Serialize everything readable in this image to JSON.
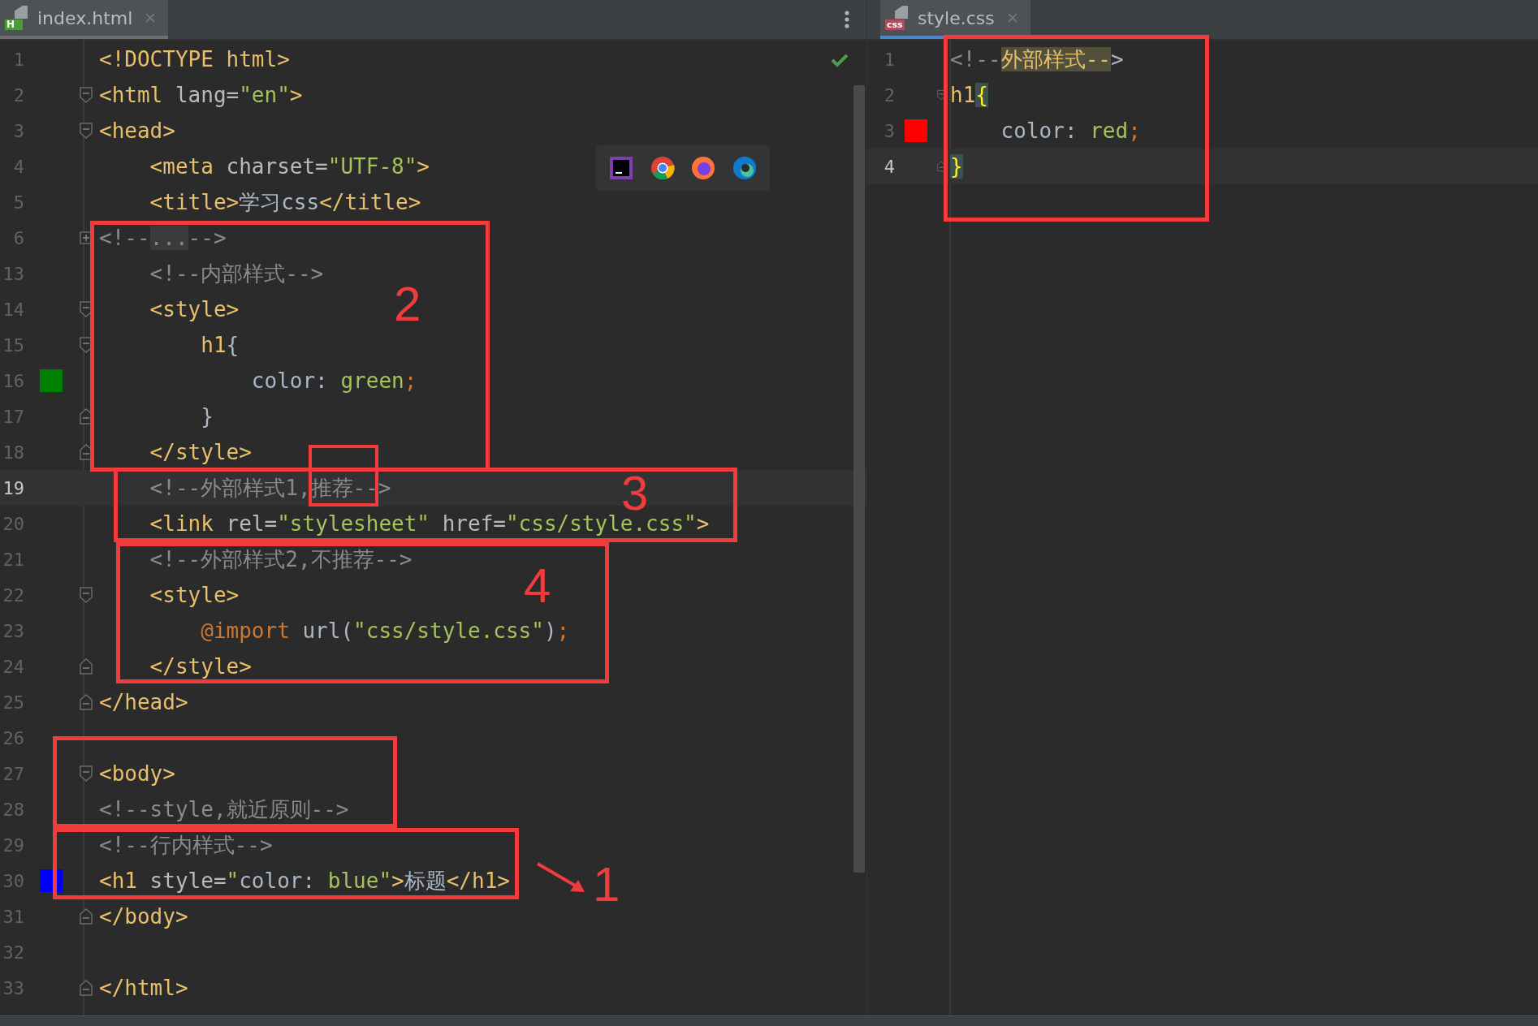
{
  "panels": [
    {
      "kind": "html",
      "tab": {
        "label": "index.html",
        "badge": "H",
        "focused": false
      },
      "lines": [
        {
          "number": "1",
          "kind": "plain",
          "current": false,
          "tokens": [
            {
              "text": "<!DOCTYPE html>",
              "kind": "tag"
            }
          ]
        },
        {
          "number": "2",
          "kind": "open",
          "current": false,
          "tokens": [
            {
              "text": "<html",
              "kind": "tag"
            },
            {
              "text": " lang=",
              "kind": "attr"
            },
            {
              "text": "\"en\"",
              "kind": "string"
            },
            {
              "text": ">",
              "kind": "tag"
            }
          ]
        },
        {
          "number": "3",
          "kind": "open",
          "current": false,
          "tokens": [
            {
              "text": "<head>",
              "kind": "tag"
            }
          ]
        },
        {
          "number": "4",
          "kind": "plain",
          "current": false,
          "tokens": [
            {
              "text": "    <meta",
              "kind": "tag"
            },
            {
              "text": " charset=",
              "kind": "attr"
            },
            {
              "text": "\"UTF-8\"",
              "kind": "string"
            },
            {
              "text": ">",
              "kind": "tag"
            }
          ]
        },
        {
          "number": "5",
          "kind": "plain",
          "current": false,
          "tokens": [
            {
              "text": "    <title>",
              "kind": "tag"
            },
            {
              "text": "学习css",
              "kind": "text"
            },
            {
              "text": "</title>",
              "kind": "tag"
            }
          ]
        },
        {
          "number": "6",
          "kind": "collapsed",
          "current": false,
          "tokens": [
            {
              "text": "<!--",
              "kind": "comment"
            },
            {
              "text": "...",
              "kind": "folded"
            },
            {
              "text": "-->",
              "kind": "comment"
            }
          ]
        },
        {
          "number": "13",
          "kind": "plain",
          "current": false,
          "tokens": [
            {
              "text": "    <!--内部样式-->",
              "kind": "comment"
            }
          ]
        },
        {
          "number": "14",
          "kind": "open",
          "current": false,
          "tokens": [
            {
              "text": "    <style>",
              "kind": "tag"
            }
          ]
        },
        {
          "number": "15",
          "kind": "open",
          "current": false,
          "tokens": [
            {
              "text": "        h1",
              "kind": "selector"
            },
            {
              "text": "{",
              "kind": "plain"
            }
          ]
        },
        {
          "number": "16",
          "kind": "plain",
          "current": false,
          "color": "#008000",
          "tokens": [
            {
              "text": "            color: ",
              "kind": "plain"
            },
            {
              "text": "green",
              "kind": "value"
            },
            {
              "text": ";",
              "kind": "punct"
            }
          ]
        },
        {
          "number": "17",
          "kind": "close",
          "current": false,
          "tokens": [
            {
              "text": "        }",
              "kind": "plain"
            }
          ]
        },
        {
          "number": "18",
          "kind": "close",
          "current": false,
          "tokens": [
            {
              "text": "    </style>",
              "kind": "tag"
            }
          ]
        },
        {
          "number": "19",
          "kind": "plain",
          "current": true,
          "tokens": [
            {
              "text": "    <!--外部样式1,推荐-->",
              "kind": "comment"
            }
          ]
        },
        {
          "number": "20",
          "kind": "plain",
          "current": false,
          "tokens": [
            {
              "text": "    <link",
              "kind": "tag"
            },
            {
              "text": " rel=",
              "kind": "attr"
            },
            {
              "text": "\"stylesheet\"",
              "kind": "string"
            },
            {
              "text": " href=",
              "kind": "attr"
            },
            {
              "text": "\"css/style.css\"",
              "kind": "string"
            },
            {
              "text": ">",
              "kind": "tag"
            }
          ]
        },
        {
          "number": "21",
          "kind": "plain",
          "current": false,
          "tokens": [
            {
              "text": "    <!--外部样式2,不推荐-->",
              "kind": "comment"
            }
          ]
        },
        {
          "number": "22",
          "kind": "open",
          "current": false,
          "tokens": [
            {
              "text": "    <style>",
              "kind": "tag"
            }
          ]
        },
        {
          "number": "23",
          "kind": "plain",
          "current": false,
          "tokens": [
            {
              "text": "        @import",
              "kind": "keyword"
            },
            {
              "text": " url(",
              "kind": "plain"
            },
            {
              "text": "\"css/style.css\"",
              "kind": "value"
            },
            {
              "text": ")",
              "kind": "plain"
            },
            {
              "text": ";",
              "kind": "punct"
            }
          ]
        },
        {
          "number": "24",
          "kind": "close",
          "current": false,
          "tokens": [
            {
              "text": "    </style>",
              "kind": "tag"
            }
          ]
        },
        {
          "number": "25",
          "kind": "close",
          "current": false,
          "tokens": [
            {
              "text": "</head>",
              "kind": "tag"
            }
          ]
        },
        {
          "number": "26",
          "kind": "plain",
          "current": false
        },
        {
          "number": "27",
          "kind": "open",
          "current": false,
          "tokens": [
            {
              "text": "<body>",
              "kind": "tag"
            }
          ]
        },
        {
          "number": "28",
          "kind": "plain",
          "current": false,
          "tokens": [
            {
              "text": "<!--style,就近原则-->",
              "kind": "comment"
            }
          ]
        },
        {
          "number": "29",
          "kind": "plain",
          "current": false,
          "tokens": [
            {
              "text": "<!--行内样式-->",
              "kind": "comment"
            }
          ]
        },
        {
          "number": "30",
          "kind": "plain",
          "current": false,
          "color": "#0000ff",
          "tokens": [
            {
              "text": "<h1",
              "kind": "tag"
            },
            {
              "text": " style=",
              "kind": "attr"
            },
            {
              "text": "\"",
              "kind": "string"
            },
            {
              "text": "color: ",
              "kind": "plain"
            },
            {
              "text": "blue",
              "kind": "value"
            },
            {
              "text": "\"",
              "kind": "string"
            },
            {
              "text": ">",
              "kind": "tag"
            },
            {
              "text": "标题",
              "kind": "text"
            },
            {
              "text": "</h1>",
              "kind": "tag"
            }
          ]
        },
        {
          "number": "31",
          "kind": "close",
          "current": false,
          "tokens": [
            {
              "text": "</body>",
              "kind": "tag"
            }
          ]
        },
        {
          "number": "32",
          "kind": "plain",
          "current": false
        },
        {
          "number": "33",
          "kind": "close",
          "current": false,
          "tokens": [
            {
              "text": "</html>",
              "kind": "tag"
            }
          ]
        }
      ]
    },
    {
      "kind": "css",
      "tab": {
        "label": "style.css",
        "badge": "css",
        "focused": true
      },
      "lines": [
        {
          "number": "1",
          "kind": "plain",
          "current": false,
          "tokens": [
            {
              "text": "<!--",
              "kind": "comment"
            },
            {
              "text": "外部样式--",
              "kind": "highlight"
            },
            {
              "text": ">",
              "kind": "plain"
            }
          ]
        },
        {
          "number": "2",
          "kind": "open",
          "current": false,
          "tokens": [
            {
              "text": "h1",
              "kind": "selector"
            },
            {
              "text": "{",
              "kind": "match"
            }
          ]
        },
        {
          "number": "3",
          "kind": "plain",
          "current": false,
          "color": "#ff0000",
          "tokens": [
            {
              "text": "    color: ",
              "kind": "plain"
            },
            {
              "text": "red",
              "kind": "value"
            },
            {
              "text": ";",
              "kind": "punct"
            }
          ]
        },
        {
          "number": "4",
          "kind": "close",
          "current": true,
          "tokens": [
            {
              "text": "}",
              "kind": "match"
            }
          ]
        }
      ]
    }
  ],
  "annotations": [
    {
      "kind": "numbered",
      "label": "2"
    },
    {
      "kind": "numbered",
      "label": "3"
    },
    {
      "kind": "frame"
    },
    {
      "kind": "numbered",
      "label": "4"
    },
    {
      "kind": "frame"
    },
    {
      "kind": "numbered",
      "label": "1"
    },
    {
      "kind": "frame"
    }
  ]
}
